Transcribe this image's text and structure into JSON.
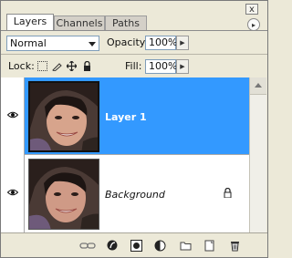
{
  "tabs": [
    {
      "label": "Layers",
      "active": true
    },
    {
      "label": "Channels",
      "active": false
    },
    {
      "label": "Paths",
      "active": false
    }
  ],
  "close_glyph": "x",
  "menu_glyph": "▸",
  "blend_mode": "Normal",
  "opacity": {
    "label": "Opacity:",
    "value": "100%"
  },
  "lock": {
    "label": "Lock:"
  },
  "fill": {
    "label": "Fill:",
    "value": "100%"
  },
  "layers": [
    {
      "name": "Layer 1",
      "selected": true,
      "visible": true,
      "locked": false
    },
    {
      "name": "Background",
      "selected": false,
      "visible": true,
      "locked": true
    }
  ],
  "colors": {
    "selection": "#3399ff",
    "panel_bg": "#ece9d8",
    "list_bg": "#ffffff"
  },
  "bottom_icons": [
    "link-layers-icon",
    "layer-style-icon",
    "layer-mask-icon",
    "adjustment-layer-icon",
    "new-group-icon",
    "new-layer-icon",
    "delete-layer-icon"
  ]
}
